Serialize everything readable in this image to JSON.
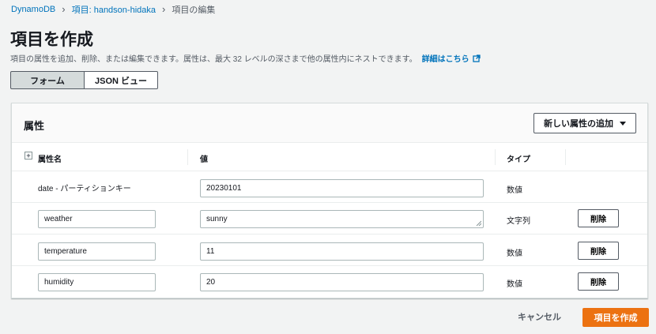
{
  "breadcrumb": {
    "items": [
      "DynamoDB",
      "項目: handson-hidaka",
      "項目の編集"
    ]
  },
  "page": {
    "title": "項目を作成",
    "description": "項目の属性を追加、削除、または編集できます。属性は、最大 32 レベルの深さまで他の属性内にネストできます。",
    "learn_more": "詳細はこちら"
  },
  "view_toggle": {
    "options": [
      "フォーム",
      "JSON ビュー"
    ],
    "selected": "フォーム"
  },
  "attributes_panel": {
    "title": "属性",
    "add_button": "新しい属性の追加",
    "columns": [
      "属性名",
      "値",
      "タイプ"
    ],
    "rows": [
      {
        "name": "date - パーティションキー",
        "value": "20230101",
        "type": "数値",
        "editable_name": false,
        "delete": ""
      },
      {
        "name": "weather",
        "value": "sunny",
        "type": "文字列",
        "editable_name": true,
        "delete": "削除"
      },
      {
        "name": "temperature",
        "value": "11",
        "type": "数値",
        "editable_name": true,
        "delete": "削除"
      },
      {
        "name": "humidity",
        "value": "20",
        "type": "数値",
        "editable_name": true,
        "delete": "削除"
      }
    ]
  },
  "footer": {
    "cancel": "キャンセル",
    "submit": "項目を作成"
  },
  "colors": {
    "link": "#0073bb",
    "primary": "#ec7211",
    "background": "#f2f3f3"
  }
}
